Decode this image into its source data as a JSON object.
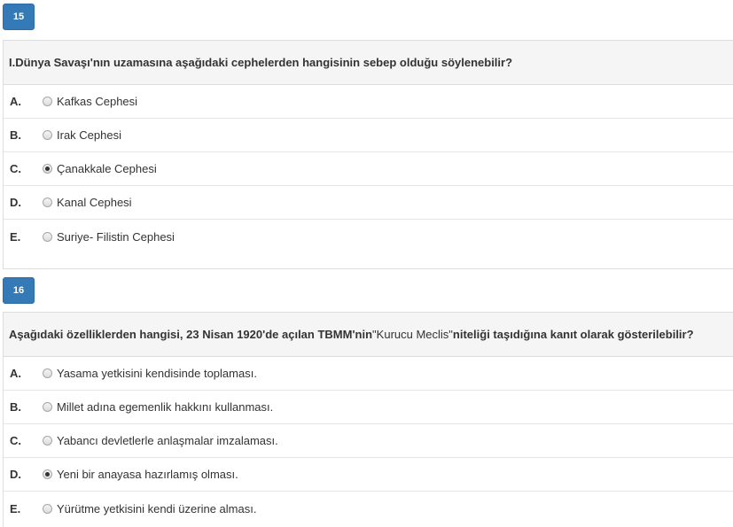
{
  "questions": [
    {
      "number": "15",
      "text": "I.Dünya Savaşı'nın uzamasına aşağıdaki cephelerden hangisinin sebep olduğu söylenebilir?",
      "options": [
        {
          "letter": "A.",
          "text": "Kafkas Cephesi",
          "selected": false
        },
        {
          "letter": "B.",
          "text": "Irak Cephesi",
          "selected": false
        },
        {
          "letter": "C.",
          "text": "Çanakkale Cephesi",
          "selected": true
        },
        {
          "letter": "D.",
          "text": "Kanal Cephesi",
          "selected": false
        },
        {
          "letter": "E.",
          "text": "Suriye- Filistin Cephesi",
          "selected": false
        }
      ]
    },
    {
      "number": "16",
      "text_before": "Aşağıdaki özelliklerden hangisi, 23 Nisan 1920'de açılan TBMM'nin ",
      "text_quote": "\"Kurucu Meclis\"",
      "text_after": " niteliği taşıdığına kanıt olarak gösterilebilir?",
      "options": [
        {
          "letter": "A.",
          "text": "Yasama yetkisini kendisinde toplaması.",
          "selected": false
        },
        {
          "letter": "B.",
          "text": "Millet adına egemenlik hakkını kullanması.",
          "selected": false
        },
        {
          "letter": "C.",
          "text": "Yabancı devletlerle anlaşmalar imzalaması.",
          "selected": false
        },
        {
          "letter": "D.",
          "text": "Yeni bir anayasa hazırlamış olması.",
          "selected": true
        },
        {
          "letter": "E.",
          "text": "Yürütme yetkisini kendi üzerine alması.",
          "selected": false
        }
      ]
    }
  ],
  "colors": {
    "badge": "#337ab7",
    "header_bg": "#f5f5f5",
    "border": "#dddddd"
  },
  "icons": {
    "radio": "radio-button-icon"
  }
}
